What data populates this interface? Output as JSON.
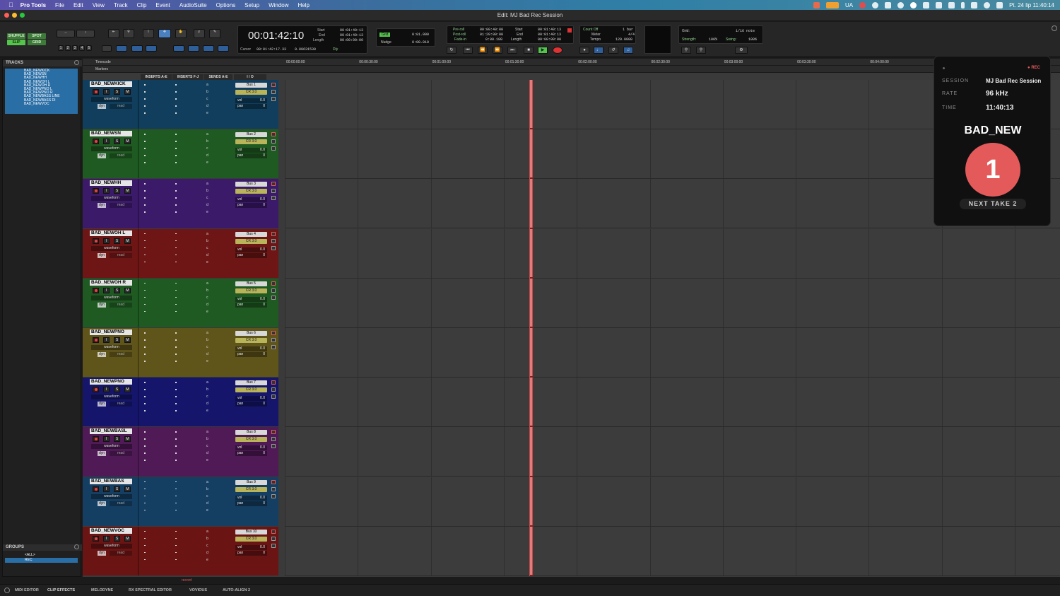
{
  "menubar": {
    "app_name": "Pro Tools",
    "items": [
      "File",
      "Edit",
      "View",
      "Track",
      "Clip",
      "Event",
      "AudioSuite",
      "Options",
      "Setup",
      "Window",
      "Help"
    ],
    "input_source": "UA",
    "datetime": "Pt. 24 lip  11:40:14"
  },
  "window": {
    "title": "Edit: MJ Bad Rec Session"
  },
  "toolbar": {
    "modes": [
      "SHUFFLE",
      "SPOT",
      "SLIP",
      "GRID"
    ],
    "zoom_presets": [
      "1",
      "2",
      "3",
      "4",
      "5"
    ],
    "main_counter": "00:01:42:10",
    "cursor_label": "Cursor",
    "cursor_value": "00:01:42:17.33",
    "cursor_sample": "0.00631530",
    "dly_label": "Dly",
    "start_label": "Start",
    "start_value": "00:01:40:13",
    "end_label": "End",
    "end_value": "00:01:40:13",
    "length_label": "Length",
    "length_value": "00:00:00:00",
    "grid_label": "Grid",
    "grid_value": "0:01.000",
    "nudge_label": "Nudge",
    "nudge_value": "0:00.010",
    "preroll_label": "Pre-roll",
    "preroll_value": "00:00:40:00",
    "postroll_label": "Post-roll",
    "postroll_value": "01:20:00:00",
    "fadein_label": "Fade-in",
    "fadein_value": "0:00.100",
    "start2_value": "00:01:40:13",
    "end2_value": "00:01:40:13",
    "length2_value": "00:00:00:00",
    "countoff_label": "Count Off",
    "countoff_value": "1 bar",
    "meter_label": "Meter",
    "meter_value": "4/4",
    "tempo_label": "Tempo",
    "tempo_value": "120.0000",
    "grid2_label": "Grid:",
    "grid2_value": "1/16 note",
    "strength_label": "Strength:",
    "strength_value": "100%",
    "swing_label": "Swing:",
    "swing_value": "100%"
  },
  "left_panel": {
    "tracks_header": "TRACKS",
    "tracks": [
      "BAD_NEWKICK",
      "BAD_NEWSN",
      "BAD_NEWHH",
      "BAD_NEWOH L",
      "BAD_NEWOH R",
      "BAD_NEWPNO L",
      "BAD_NEWPNO R",
      "BAD_NEWBASS LINE",
      "BAD_NEWBASS DI",
      "BAD_NEWVOC"
    ],
    "groups_header": "GROUPS",
    "groups": [
      "<ALL>",
      "REC"
    ]
  },
  "rulers": {
    "timecode": "Timecode",
    "markers": "Markers"
  },
  "columns": [
    "INSERTS A-E",
    "INSERTS F-J",
    "SENDS A-E",
    "I / O"
  ],
  "timeline_ticks": [
    "00:00:00:00",
    "00:00:30:00",
    "00:01:00:00",
    "00:01:30:00",
    "00:02:00:00",
    "00:02:30:00",
    "00:03:00:00",
    "00:03:30:00",
    "00:04:00:00"
  ],
  "tracks": [
    {
      "name": "BAD_NEWKICK",
      "bus": "Bus 1",
      "color": "#103e5c"
    },
    {
      "name": "BAD_NEWSN",
      "bus": "Bus 2",
      "color": "#1f5a22"
    },
    {
      "name": "BAD_NEWHH",
      "bus": "Bus 3",
      "color": "#3b1a6a"
    },
    {
      "name": "BAD_NEWOH L",
      "bus": "Bus 4",
      "color": "#6e1616"
    },
    {
      "name": "BAD_NEWOH R",
      "bus": "Bus 5",
      "color": "#1f5a22"
    },
    {
      "name": "BAD_NEWPNO",
      "bus": "Bus 6",
      "color": "#5f541a"
    },
    {
      "name": "BAD_NEWPNO",
      "bus": "Bus 7",
      "color": "#15166b"
    },
    {
      "name": "BAD_NEWBASL",
      "bus": "Bus 8",
      "color": "#4f1a56"
    },
    {
      "name": "BAD_NEWBAS",
      "bus": "Bus 9",
      "color": "#143e62"
    },
    {
      "name": "BAD_NEWVOC",
      "bus": "Bus 10",
      "color": "#6a1414"
    }
  ],
  "track_common": {
    "output": "CR 3.0",
    "waveform": "waveform",
    "dyn": "dyn",
    "read": "read",
    "vol_label": "vol",
    "vol_value": "0.0",
    "pan_label": "pan",
    "pan_value": "0",
    "btn_i": "I",
    "btn_s": "S",
    "btn_m": "M",
    "sends": [
      "a",
      "b",
      "c",
      "d",
      "e"
    ]
  },
  "bottom_tabs": [
    "MIDI EDITOR",
    "CLIP EFFECTS",
    "MELODYNE",
    "RX SPECTRAL EDITOR",
    "VOVIOUS",
    "AUTO-ALIGN 2"
  ],
  "bottom_record_label": "record",
  "overlay": {
    "rec_label": "REC",
    "session_label": "SESSION",
    "session_value": "MJ Bad Rec Session",
    "rate_label": "RATE",
    "rate_value": "96 kHz",
    "time_label": "TIME",
    "time_value": "11:40:13",
    "track_name": "BAD_NEW",
    "take_number": "1",
    "next_take": "NEXT TAKE 2"
  },
  "colors": {
    "accent_rec": "#e45a5a",
    "playhead": "#e77b7b",
    "selection": "#2a6ea6"
  }
}
